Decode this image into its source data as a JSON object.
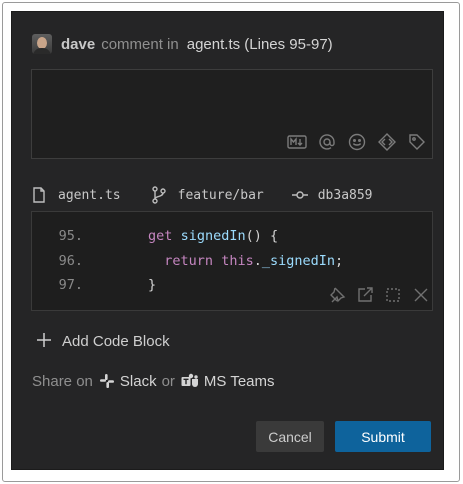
{
  "header": {
    "username": "dave",
    "action_text": "comment in",
    "file_ref": "agent.ts (Lines 95-97)"
  },
  "comment_box": {
    "value": "",
    "tools": [
      "markdown-icon",
      "mention-icon",
      "emoji-icon",
      "code-icon",
      "tag-icon"
    ]
  },
  "meta": {
    "file": "agent.ts",
    "branch": "feature/bar",
    "commit": "db3a859"
  },
  "code": {
    "lines": [
      {
        "num": "95.",
        "indent": "   ",
        "tokens": [
          {
            "t": "get",
            "c": "kw"
          },
          {
            "t": " ",
            "c": "pl"
          },
          {
            "t": "signedIn",
            "c": "fn"
          },
          {
            "t": "() {",
            "c": "pl"
          }
        ]
      },
      {
        "num": "96.",
        "indent": "     ",
        "tokens": [
          {
            "t": "return",
            "c": "kw"
          },
          {
            "t": " ",
            "c": "pl"
          },
          {
            "t": "this",
            "c": "kw"
          },
          {
            "t": ".",
            "c": "pl"
          },
          {
            "t": "_signedIn",
            "c": "fn"
          },
          {
            "t": ";",
            "c": "pl"
          }
        ]
      },
      {
        "num": "97.",
        "indent": "   ",
        "tokens": [
          {
            "t": "}",
            "c": "pl"
          }
        ]
      }
    ]
  },
  "add_block": {
    "label": "Add Code Block"
  },
  "share": {
    "prefix": "Share on",
    "slack": "Slack",
    "or": "or",
    "teams": "MS Teams"
  },
  "buttons": {
    "cancel": "Cancel",
    "submit": "Submit"
  },
  "colors": {
    "accent": "#0e639c",
    "panel": "#252526",
    "keyword": "#c586c0",
    "identifier": "#9cdcfe"
  }
}
